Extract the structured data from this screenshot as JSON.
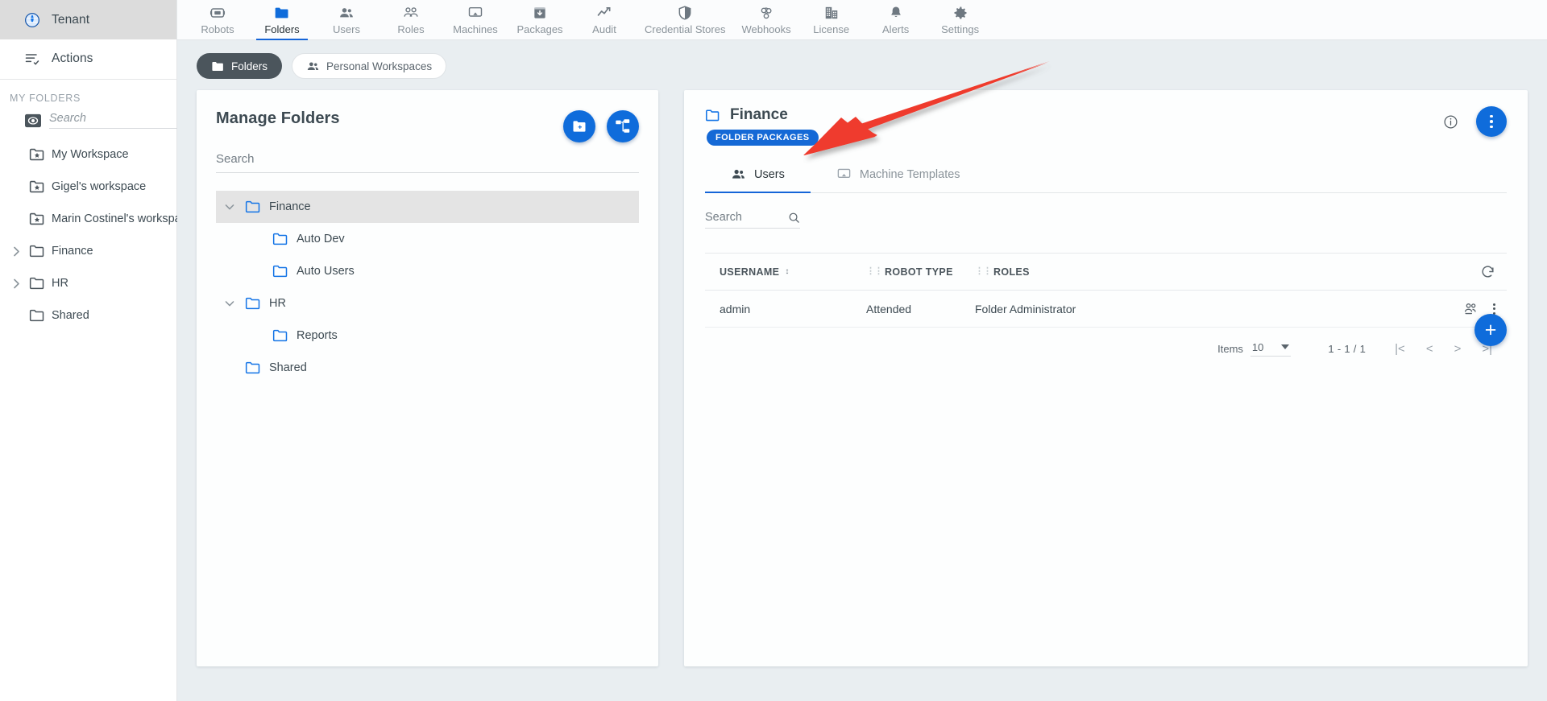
{
  "sidebar": {
    "tenant": {
      "label": "Tenant",
      "icon": "globe-icon"
    },
    "actions": {
      "label": "Actions",
      "icon": "actions-list-icon"
    },
    "section_title": "MY FOLDERS",
    "search": {
      "placeholder": "Search",
      "value": "",
      "icon": "search-icon",
      "prefix_icon": "eye-toggle-icon"
    },
    "folders": [
      {
        "label": "My Workspace",
        "icon": "workspace-folder-icon",
        "expandable": false,
        "indent": 1
      },
      {
        "label": "Gigel's workspace",
        "icon": "workspace-folder-icon",
        "expandable": false,
        "indent": 1
      },
      {
        "label": "Marin Costinel's workspace",
        "icon": "workspace-folder-icon",
        "expandable": false,
        "indent": 1
      },
      {
        "label": "Finance",
        "icon": "folder-icon",
        "expandable": true,
        "indent": 0
      },
      {
        "label": "HR",
        "icon": "folder-icon",
        "expandable": true,
        "indent": 0
      },
      {
        "label": "Shared",
        "icon": "folder-icon",
        "expandable": false,
        "indent": 1
      }
    ]
  },
  "topnav": {
    "items": [
      {
        "label": "Robots",
        "icon": "robot-icon",
        "active": false
      },
      {
        "label": "Folders",
        "icon": "folder-icon",
        "active": true
      },
      {
        "label": "Users",
        "icon": "users-icon",
        "active": false
      },
      {
        "label": "Roles",
        "icon": "roles-icon",
        "active": false
      },
      {
        "label": "Machines",
        "icon": "machine-monitor-icon",
        "active": false
      },
      {
        "label": "Packages",
        "icon": "package-download-icon",
        "active": false
      },
      {
        "label": "Audit",
        "icon": "audit-chart-icon",
        "active": false
      },
      {
        "label": "Credential Stores",
        "icon": "shield-icon",
        "active": false
      },
      {
        "label": "Webhooks",
        "icon": "webhook-icon",
        "active": false
      },
      {
        "label": "License",
        "icon": "building-icon",
        "active": false
      },
      {
        "label": "Alerts",
        "icon": "bell-icon",
        "active": false
      },
      {
        "label": "Settings",
        "icon": "gear-icon",
        "active": false
      }
    ]
  },
  "chips": [
    {
      "label": "Folders",
      "icon": "folder-icon",
      "selected": true
    },
    {
      "label": "Personal Workspaces",
      "icon": "users-icon",
      "selected": false
    }
  ],
  "left_panel": {
    "title": "Manage Folders",
    "add_folder_button": {
      "name": "add-folder-button",
      "icon": "folder-plus-icon"
    },
    "hierarchy_button": {
      "name": "folder-hierarchy-button",
      "icon": "org-chart-icon"
    },
    "search": {
      "placeholder": "Search",
      "value": ""
    },
    "tree": [
      {
        "label": "Finance",
        "indent": 0,
        "expandable": true,
        "expanded": true,
        "selected": true
      },
      {
        "label": "Auto Dev",
        "indent": 1,
        "expandable": false,
        "expanded": false,
        "selected": false
      },
      {
        "label": "Auto Users",
        "indent": 1,
        "expandable": false,
        "expanded": false,
        "selected": false
      },
      {
        "label": "HR",
        "indent": 0,
        "expandable": true,
        "expanded": true,
        "selected": false
      },
      {
        "label": "Reports",
        "indent": 1,
        "expandable": false,
        "expanded": false,
        "selected": false
      },
      {
        "label": "Shared",
        "indent": 0,
        "expandable": false,
        "expanded": false,
        "selected": false
      }
    ]
  },
  "right_panel": {
    "title": "Finance",
    "badge": "FOLDER PACKAGES",
    "info_icon": "info-icon",
    "more_button_icon": "kebab-menu-icon",
    "tabs": [
      {
        "label": "Users",
        "icon": "users-icon",
        "active": true
      },
      {
        "label": "Machine Templates",
        "icon": "machine-monitor-icon",
        "active": false
      }
    ],
    "search": {
      "placeholder": "Search",
      "value": "",
      "icon": "search-icon"
    },
    "add_button": {
      "name": "add-user-button",
      "icon": "plus-icon",
      "label": "+"
    },
    "refresh_icon": "refresh-icon",
    "table": {
      "columns": [
        "USERNAME",
        "ROBOT TYPE",
        "ROLES"
      ],
      "sort_column": "USERNAME",
      "rows": [
        {
          "username": "admin",
          "robot_type": "Attended",
          "roles": "Folder Administrator",
          "row_icons": [
            "manage-user-icon",
            "kebab-menu-icon"
          ]
        }
      ]
    },
    "footer": {
      "items_label": "Items",
      "items_per_page": "10",
      "range": "1 - 1 / 1",
      "first_page": "|<",
      "prev_page": "<",
      "next_page": ">",
      "last_page": ">|"
    }
  },
  "annotation": {
    "type": "arrow",
    "color": "#ef3b2d"
  },
  "colors": {
    "accent_blue": "#0f6cdb",
    "badge_blue": "#1569d6",
    "folder_blue": "#1273e6",
    "sidebar_selected": "#dcdcdc",
    "canvas": "#e9eef1",
    "panel": "#fdfefe",
    "text_dark": "#3d4a52",
    "text_muted": "#8b949b",
    "arrow_red": "#ef3b2d"
  }
}
